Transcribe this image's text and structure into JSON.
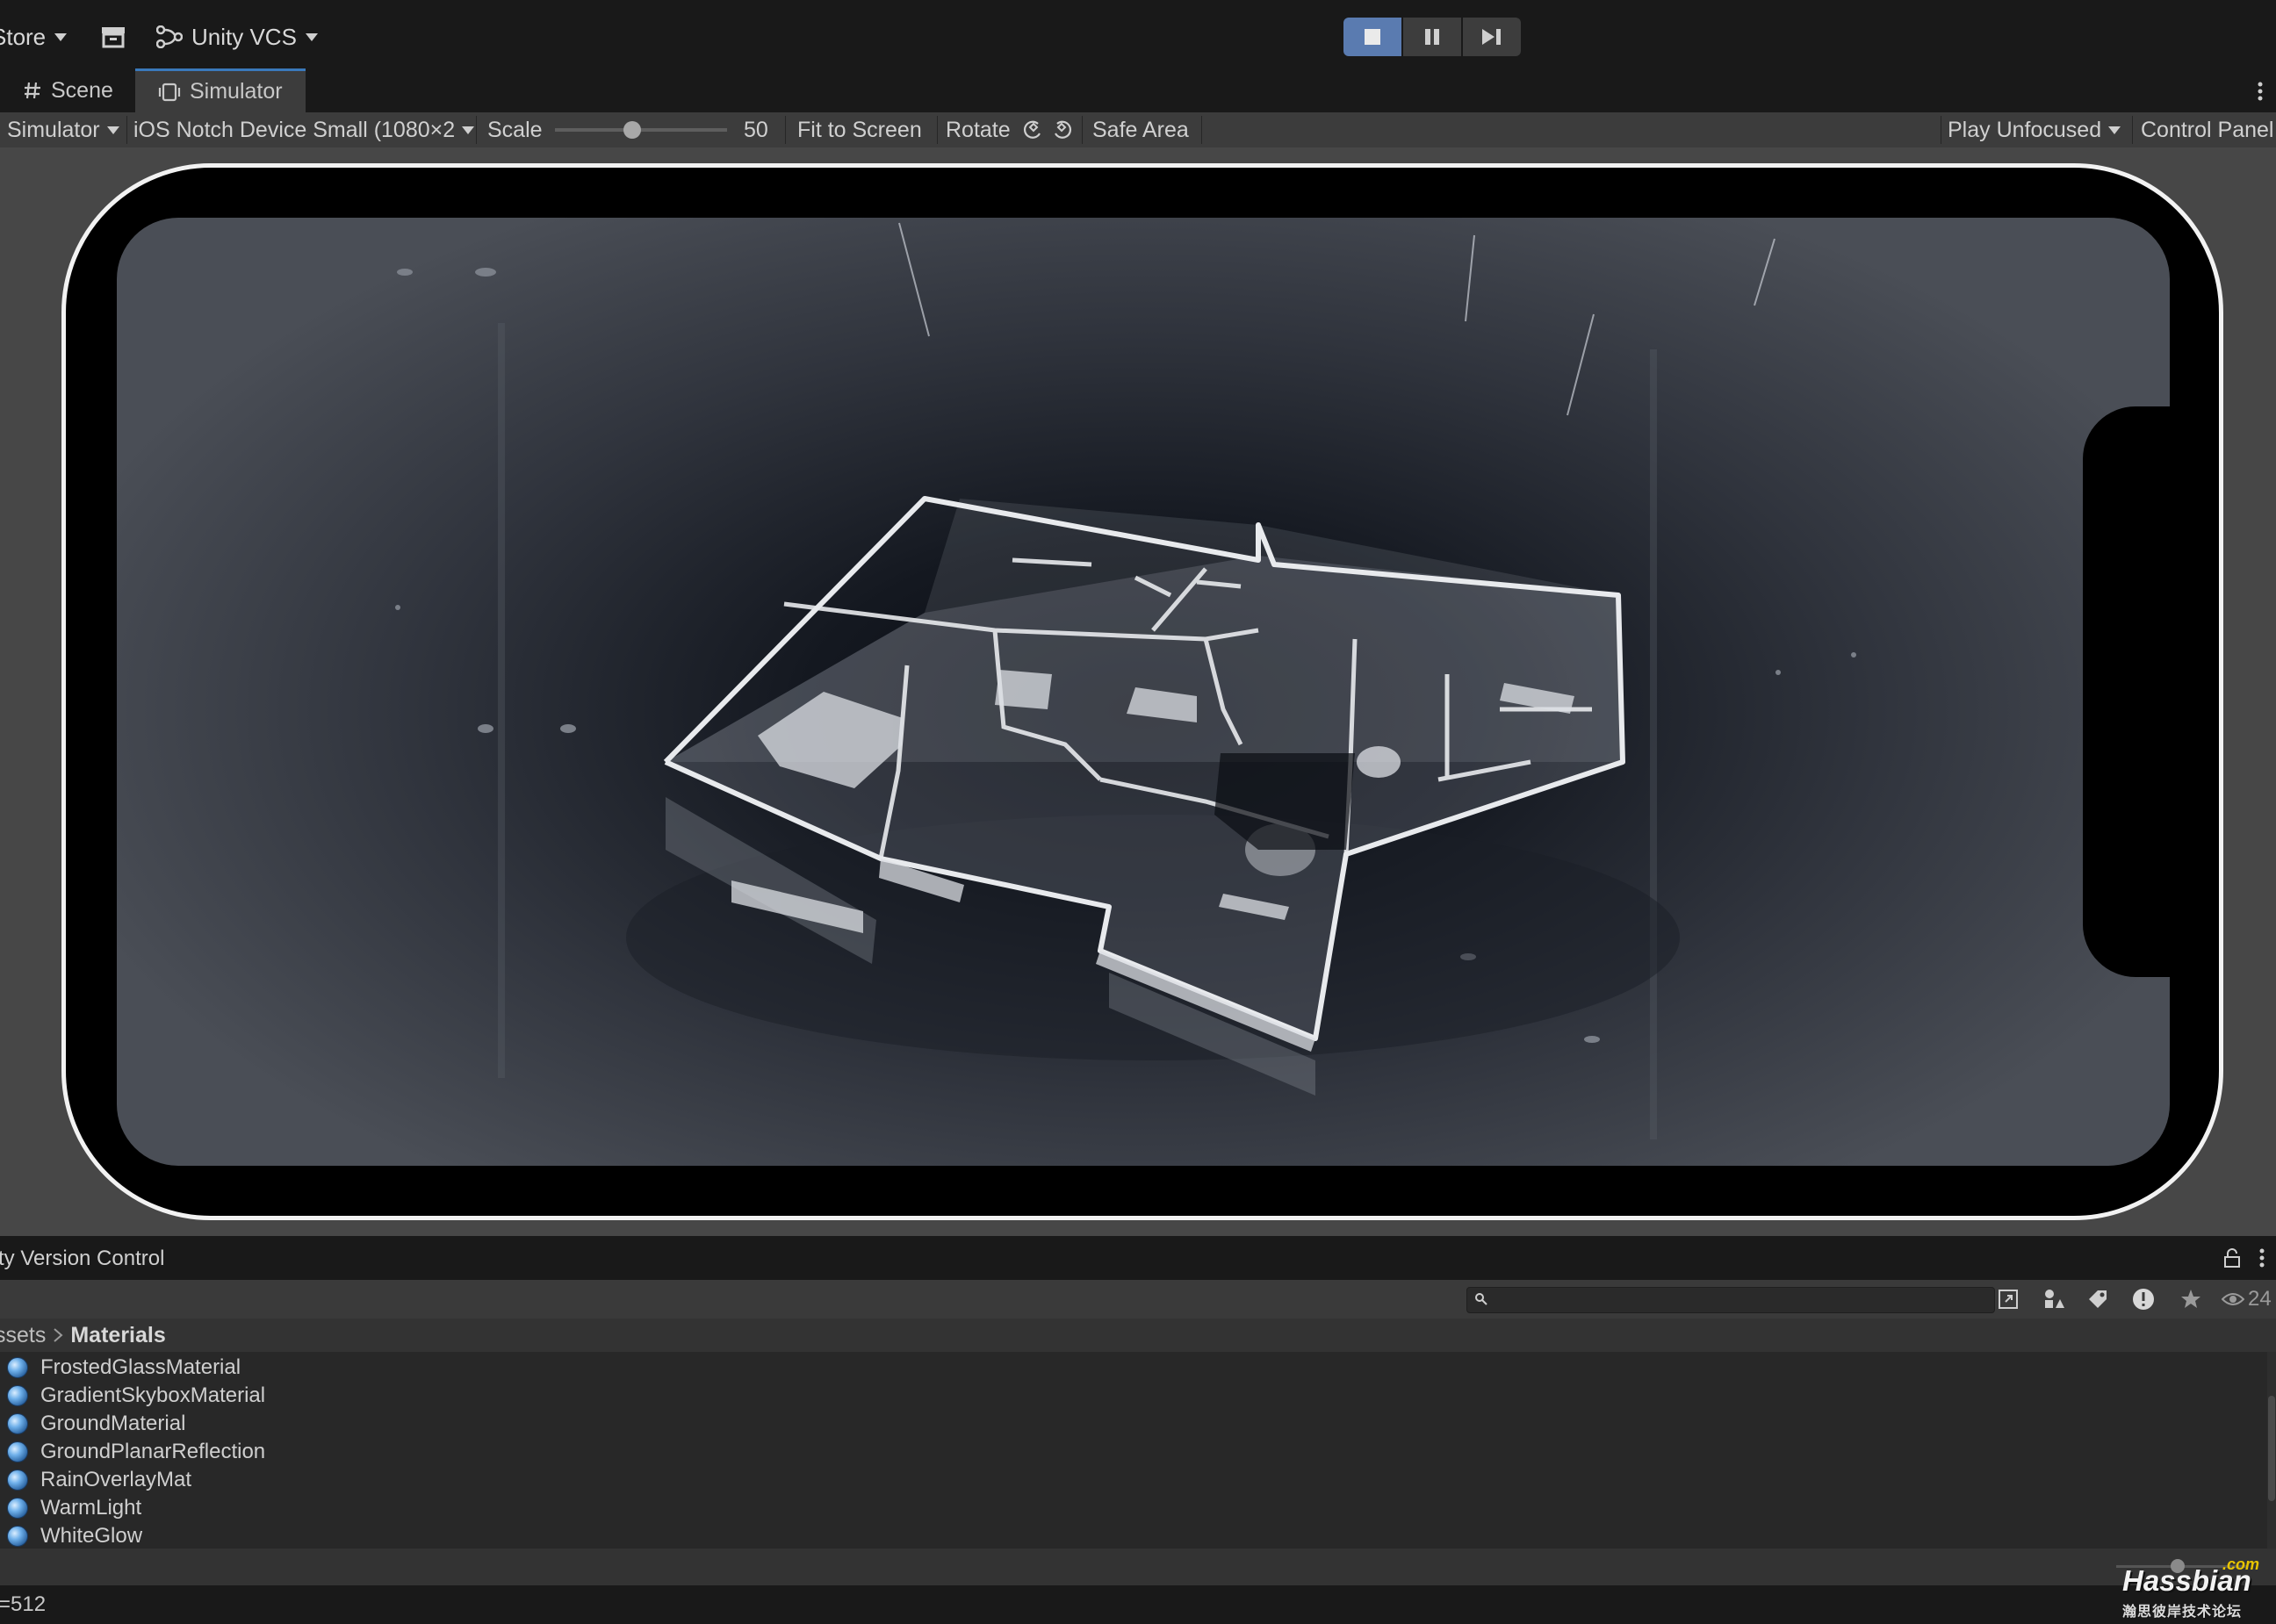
{
  "toolbar": {
    "store_label": "Store",
    "vcs_label": "Unity VCS",
    "play_controls": [
      "stop",
      "pause",
      "step"
    ]
  },
  "tabs": [
    {
      "label": "Scene"
    },
    {
      "label": "Simulator"
    }
  ],
  "simulator_bar": {
    "mode": "Simulator",
    "device": "iOS Notch Device Small (1080×2",
    "scale_label": "Scale",
    "scale_value": "50",
    "scale_fraction": 0.45,
    "fit_label": "Fit to Screen",
    "rotate_label": "Rotate",
    "safe_area_label": "Safe Area",
    "play_mode": "Play Unfocused",
    "control_panel": "Control Panel"
  },
  "panel": {
    "title": "Unity Version Control",
    "visible_title": "ty Version Control",
    "hidden_count": "24",
    "breadcrumb": [
      "ssets",
      "Materials"
    ]
  },
  "assets": [
    {
      "name": "FrostedGlassMaterial"
    },
    {
      "name": "GradientSkyboxMaterial"
    },
    {
      "name": "GroundMaterial"
    },
    {
      "name": "GroundPlanarReflection"
    },
    {
      "name": "RainOverlayMat"
    },
    {
      "name": "WarmLight"
    },
    {
      "name": "WhiteGlow"
    }
  ],
  "status": {
    "text": "=512"
  },
  "watermark": {
    "brand": "Hassbian",
    "suffix": ".com",
    "subtitle": "瀚思彼岸技术论坛"
  },
  "colors": {
    "accent": "#3a79bb",
    "play_active": "#5a7bb0",
    "material_icon": "#6fb0ea"
  }
}
